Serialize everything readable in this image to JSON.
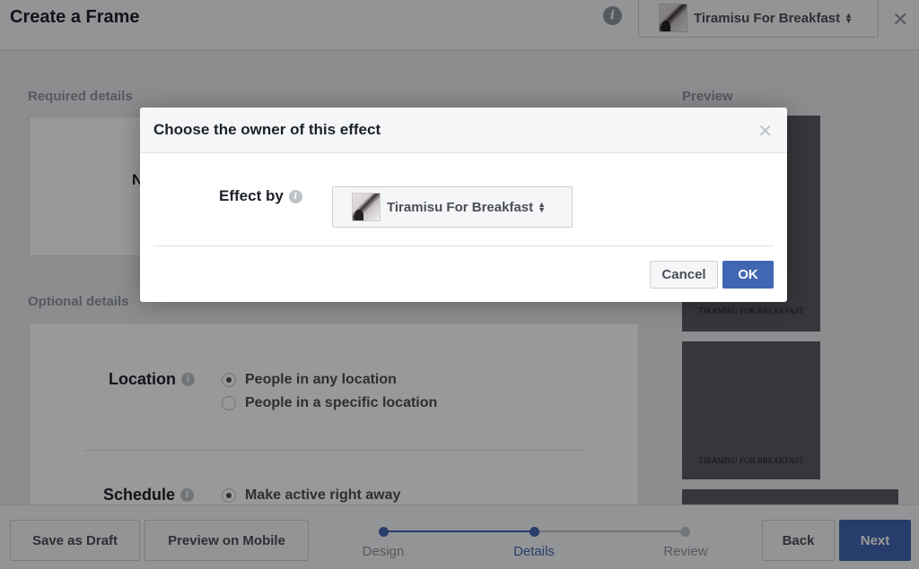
{
  "header": {
    "title": "Create a Frame",
    "info_icon": "info-icon",
    "owner_select": {
      "value": "Tiramisu For Breakfast",
      "icon": "sort-arrows-icon"
    },
    "close_icon": "close-icon"
  },
  "main": {
    "required_label": "Required details",
    "required_text_partial": "N",
    "optional_label": "Optional details",
    "location": {
      "label": "Location",
      "options": [
        {
          "label": "People in any location",
          "checked": true
        },
        {
          "label": "People in a specific location",
          "checked": false
        }
      ]
    },
    "schedule": {
      "label": "Schedule",
      "options": [
        {
          "label": "Make active right away",
          "checked": true
        }
      ]
    }
  },
  "preview": {
    "label": "Preview",
    "captions": [
      "TIRAMISU FOR BREAKFAST",
      "TIRAMISU FOR BREAKFAST"
    ]
  },
  "footer": {
    "save_draft": "Save as Draft",
    "preview_mobile": "Preview on Mobile",
    "steps": [
      {
        "label": "Design",
        "state": "done"
      },
      {
        "label": "Details",
        "state": "active"
      },
      {
        "label": "Review",
        "state": "pending"
      }
    ],
    "back": "Back",
    "next": "Next"
  },
  "dialog": {
    "title": "Choose the owner of this effect",
    "effect_by_label": "Effect by",
    "effect_by_value": "Tiramisu For Breakfast",
    "cancel": "Cancel",
    "ok": "OK"
  },
  "colors": {
    "accent": "#4267b2",
    "overlay": "rgba(0,0,0,0.4)"
  }
}
